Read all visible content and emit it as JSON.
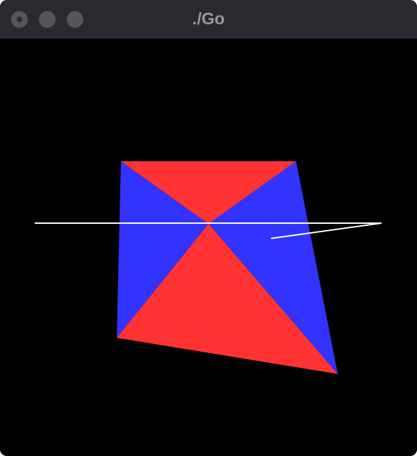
{
  "window": {
    "title": "./Go"
  },
  "colors": {
    "titlebar": "#2b2930",
    "canvas_background": "#000000",
    "red_triangle": "#ff3333",
    "blue_triangle": "#3333ff",
    "line": "#ffffff"
  }
}
